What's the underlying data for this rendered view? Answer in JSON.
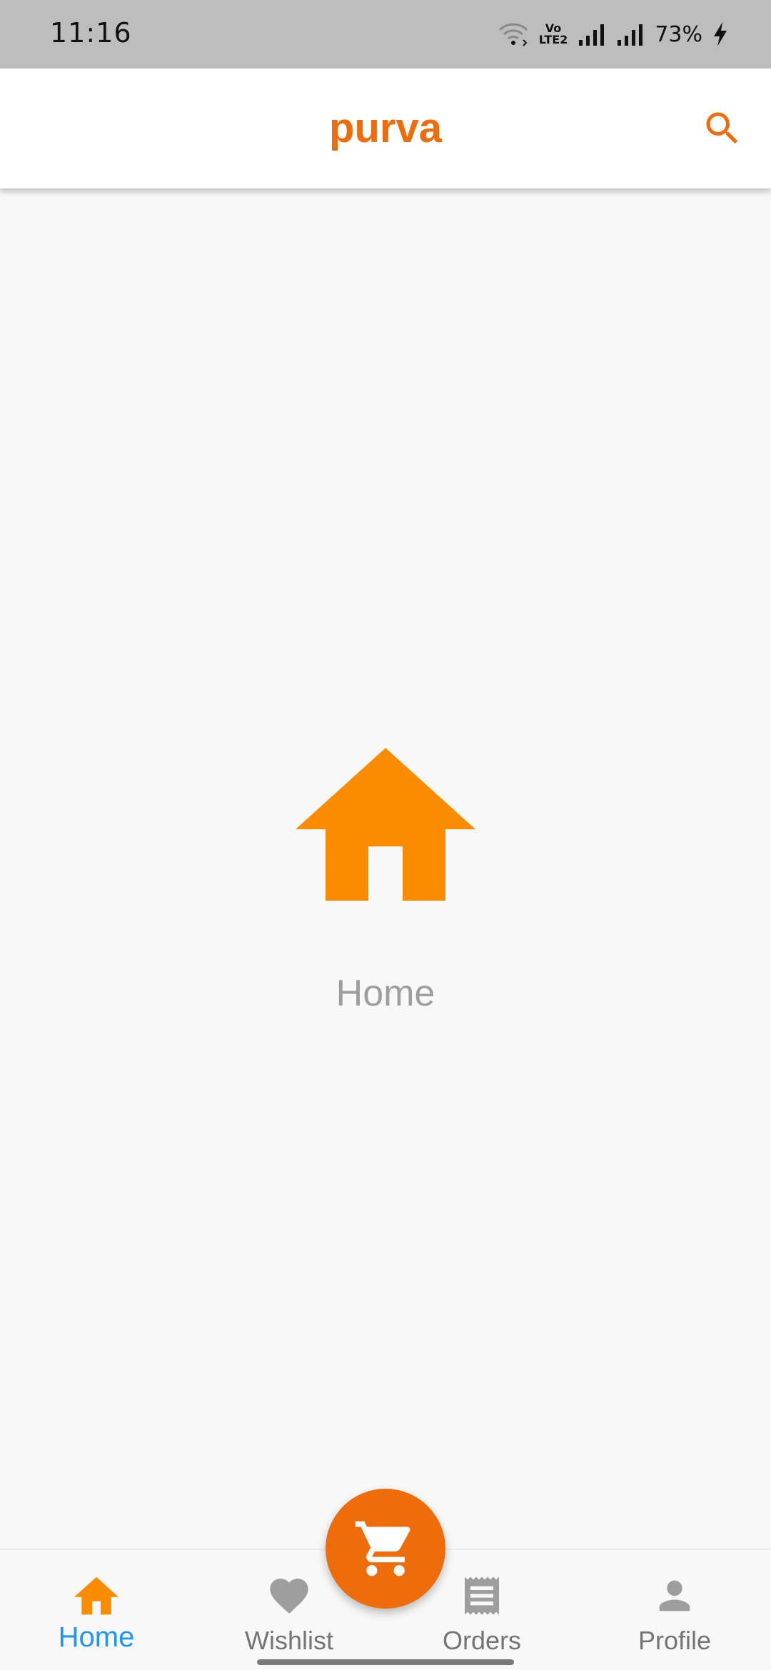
{
  "status_bar": {
    "time": "11:16",
    "battery": "73%",
    "volte_line1": "Vo",
    "volte_line2": "LTE2"
  },
  "app_bar": {
    "title": "purva",
    "search_icon": "search-icon"
  },
  "main": {
    "icon": "home-icon",
    "label": "Home"
  },
  "fab": {
    "icon": "cart-icon"
  },
  "bottom_nav": {
    "items": [
      {
        "label": "Home",
        "icon": "home-icon",
        "active": true
      },
      {
        "label": "Wishlist",
        "icon": "heart-icon",
        "active": false
      },
      {
        "label": "Orders",
        "icon": "receipt-icon",
        "active": false
      },
      {
        "label": "Profile",
        "icon": "person-icon",
        "active": false
      }
    ]
  },
  "colors": {
    "accent": "#ee6c0a",
    "hero_icon": "#fb8c00",
    "active_label": "#2196f3",
    "inactive": "#9e9e9e",
    "status_bar": "#bdbdbd"
  }
}
